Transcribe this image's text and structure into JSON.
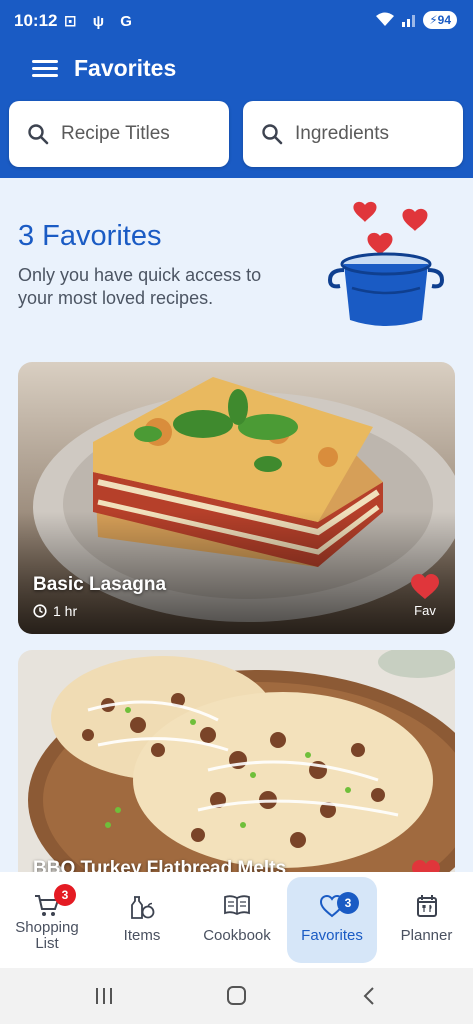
{
  "status": {
    "time": "10:12",
    "left_icons": "⊡ ψ G",
    "battery": "94"
  },
  "appbar": {
    "title": "Favorites"
  },
  "search": {
    "recipe_placeholder": "Recipe Titles",
    "ingredient_placeholder": "Ingredients"
  },
  "hero": {
    "title": "3 Favorites",
    "subtitle": "Only you have quick access to your most loved recipes."
  },
  "recipes": [
    {
      "name": "Basic Lasagna",
      "time": "1 hr",
      "fav_label": "Fav"
    },
    {
      "name": "BBQ Turkey Flatbread Melts"
    }
  ],
  "nav": {
    "shopping": {
      "label": "Shopping List",
      "badge": "3"
    },
    "items": {
      "label": "Items"
    },
    "cookbook": {
      "label": "Cookbook"
    },
    "favorites": {
      "label": "Favorites",
      "badge": "3"
    },
    "planner": {
      "label": "Planner"
    }
  },
  "colors": {
    "primary": "#1a5bc4",
    "heart": "#e0363b",
    "badge_red": "#e41b23",
    "active_tab_bg": "#d6e6f8"
  }
}
